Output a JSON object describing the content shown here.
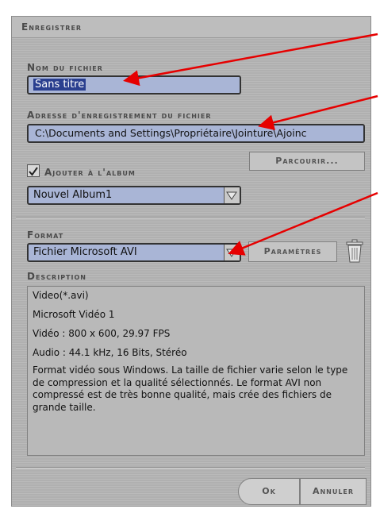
{
  "dialog": {
    "title": "Enregistrer"
  },
  "filename": {
    "label": "Nom du fichier",
    "value": "Sans titre"
  },
  "save_location": {
    "label": "Adresse d'enregistrement du fichier",
    "value": "C:\\Documents and Settings\\Propriétaire\\Jointure\\Ajoinc",
    "browse_label": "Parcourir..."
  },
  "album": {
    "checkbox_label": "Ajouter à l'album",
    "checked": true,
    "selected": "Nouvel Album1"
  },
  "format": {
    "label": "Format",
    "selected": "Fichier Microsoft AVI",
    "params_label": "Paramètres"
  },
  "description": {
    "label": "Description",
    "lines": [
      "Video(*.avi)",
      "Microsoft Vidéo 1",
      "Vidéo : 800 x 600,  29.97 FPS",
      "Audio : 44.1 kHz,  16 Bits,  Stéréo"
    ],
    "paragraph": "Format vidéo sous Windows. La taille de fichier varie selon le type de compression et la qualité sélectionnés. Le format AVI non compressé est de très bonne qualité, mais crée des fichiers de grande taille."
  },
  "buttons": {
    "ok": "Ok",
    "cancel": "Annuler"
  },
  "colors": {
    "annotation_arrow": "#e60000",
    "field_bg": "#a9b5d6"
  },
  "icons": {
    "checkbox": "checkmark-icon",
    "dropdown": "triangle-down-icon",
    "delete": "trash-icon"
  }
}
